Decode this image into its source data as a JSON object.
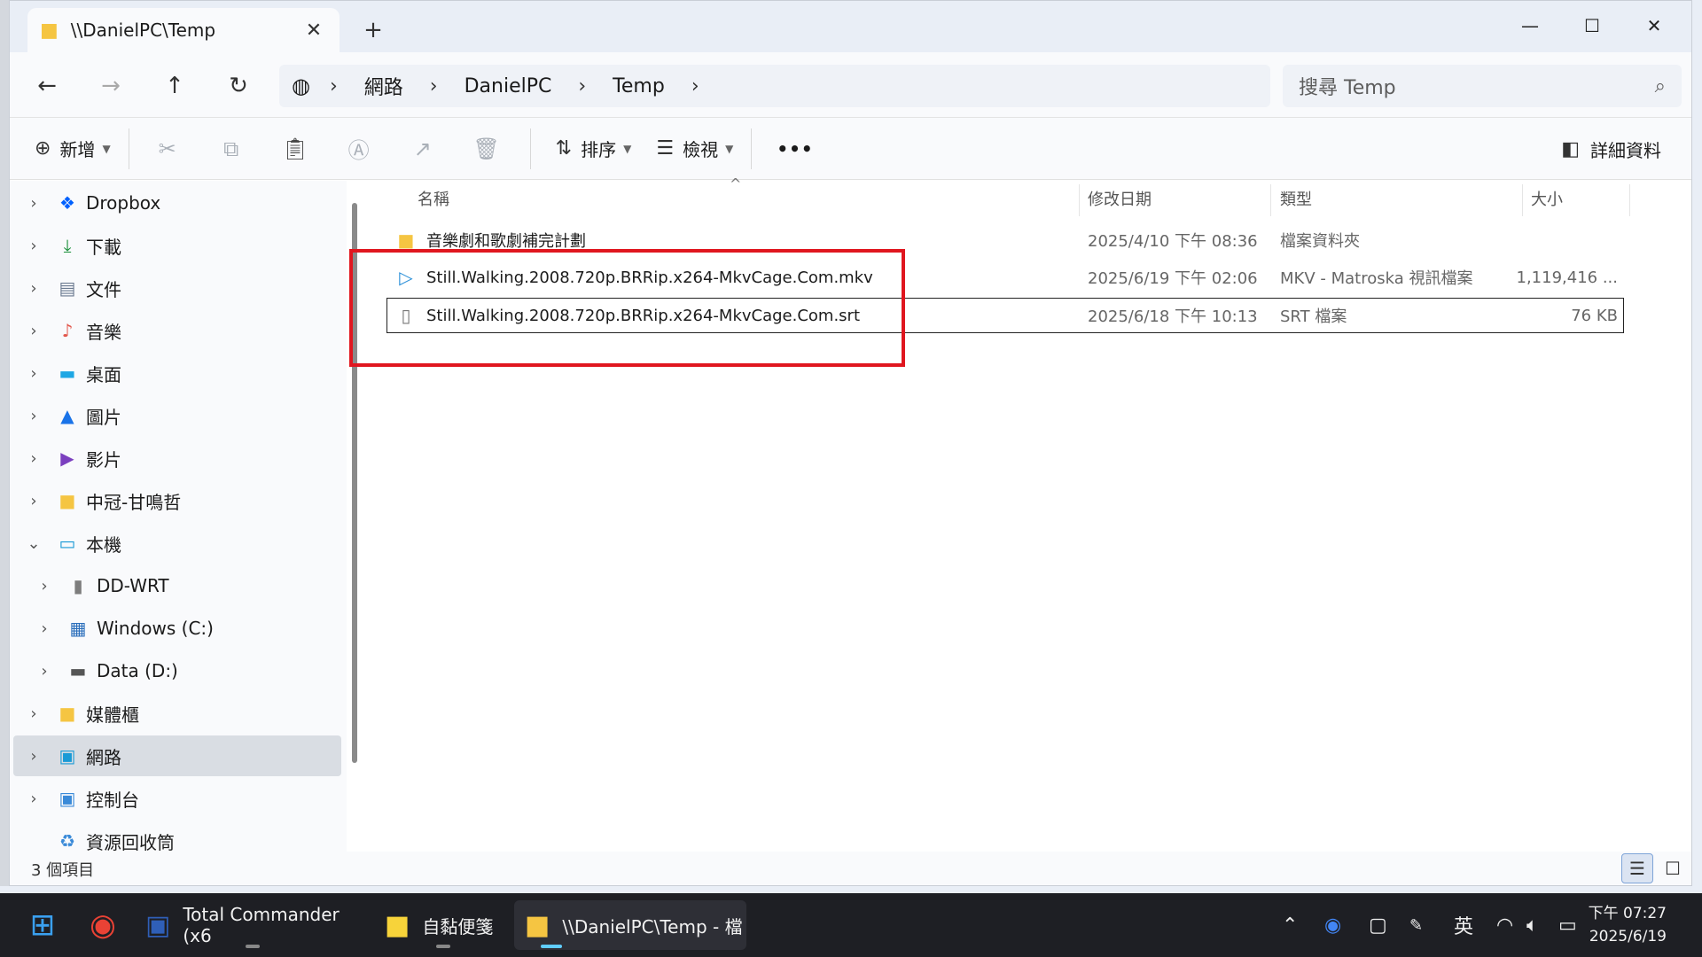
{
  "window": {
    "tab_title": "\\\\DanielPC\\Temp",
    "tab_close": "✕",
    "new_tab": "+",
    "controls": {
      "minimize": "—",
      "maximize": "☐",
      "close": "✕"
    }
  },
  "nav": {
    "back": "←",
    "forward": "→",
    "up": "↑",
    "refresh": "↻",
    "breadcrumb_icon": "globe-icon",
    "breadcrumb": [
      "網路",
      "DanielPC",
      "Temp"
    ],
    "chevron": "›"
  },
  "search": {
    "placeholder": "搜尋 Temp",
    "icon": "⌕"
  },
  "toolbar": {
    "new_label": "新增",
    "sort_label": "排序",
    "view_label": "檢視",
    "more": "•••",
    "details_label": "詳細資料"
  },
  "sidebar": {
    "items": [
      {
        "label": "Dropbox",
        "icon": "dropbox-icon",
        "glyph": "❖",
        "color": "#0061fe"
      },
      {
        "label": "下載",
        "icon": "download-icon",
        "glyph": "⤓",
        "color": "#1a8f3a"
      },
      {
        "label": "文件",
        "icon": "document-icon",
        "glyph": "▤",
        "color": "#6b7a90"
      },
      {
        "label": "音樂",
        "icon": "music-icon",
        "glyph": "♪",
        "color": "#e2574c"
      },
      {
        "label": "桌面",
        "icon": "desktop-icon",
        "glyph": "▬",
        "color": "#1ea7e4"
      },
      {
        "label": "圖片",
        "icon": "pictures-icon",
        "glyph": "▲",
        "color": "#1a73e8"
      },
      {
        "label": "影片",
        "icon": "videos-icon",
        "glyph": "▶",
        "color": "#7b3fbf"
      },
      {
        "label": "中冠-甘鳴哲",
        "icon": "folder-icon",
        "glyph": "■",
        "color": "#f5c542"
      },
      {
        "label": "本機",
        "icon": "this-pc-icon",
        "glyph": "▭",
        "color": "#1a9ad6"
      },
      {
        "label": "DD-WRT",
        "icon": "network-drive-icon",
        "glyph": "▮",
        "color": "#7d7d7d"
      },
      {
        "label": "Windows (C:)",
        "icon": "drive-c-icon",
        "glyph": "▦",
        "color": "#2a6ebb"
      },
      {
        "label": "Data (D:)",
        "icon": "drive-d-icon",
        "glyph": "▬",
        "color": "#555555"
      },
      {
        "label": "媒體櫃",
        "icon": "libraries-icon",
        "glyph": "■",
        "color": "#f5c542"
      },
      {
        "label": "網路",
        "icon": "network-icon",
        "glyph": "▣",
        "color": "#1a9ad6"
      },
      {
        "label": "控制台",
        "icon": "control-panel-icon",
        "glyph": "▣",
        "color": "#3a8ad8"
      },
      {
        "label": "資源回收筒",
        "icon": "recycle-bin-icon",
        "glyph": "♻",
        "color": "#3a8ad8"
      }
    ]
  },
  "columns": {
    "name": "名稱",
    "date": "修改日期",
    "type": "類型",
    "size": "大小",
    "sort_indicator": "^"
  },
  "files": [
    {
      "name": "音樂劇和歌劇補完計劃",
      "date": "2025/4/10 下午 08:36",
      "type": "檔案資料夾",
      "size": "",
      "icon": "folder-icon",
      "glyph": "■",
      "color": "#f5c542"
    },
    {
      "name": "Still.Walking.2008.720p.BRRip.x264-MkvCage.Com.mkv",
      "date": "2025/6/19 下午 02:06",
      "type": "MKV - Matroska 視訊檔案",
      "size": "1,119,416 ...",
      "icon": "video-file-icon",
      "glyph": "▷",
      "color": "#2a8fd8"
    },
    {
      "name": "Still.Walking.2008.720p.BRRip.x264-MkvCage.Com.srt",
      "date": "2025/6/18 下午 10:13",
      "type": "SRT 檔案",
      "size": "76 KB",
      "icon": "file-icon",
      "glyph": "▯",
      "color": "#777777"
    }
  ],
  "status": {
    "count": "3 個項目"
  },
  "taskbar": {
    "total_commander": "Total Commander (x6",
    "sticky_notes": "自黏便箋",
    "explorer": "\\\\DanielPC\\Temp - 檔",
    "ime": "英",
    "time": "下午 07:27",
    "date": "2025/6/19"
  },
  "colors": {
    "highlight": "#e0161f",
    "accent": "#60cdff"
  }
}
